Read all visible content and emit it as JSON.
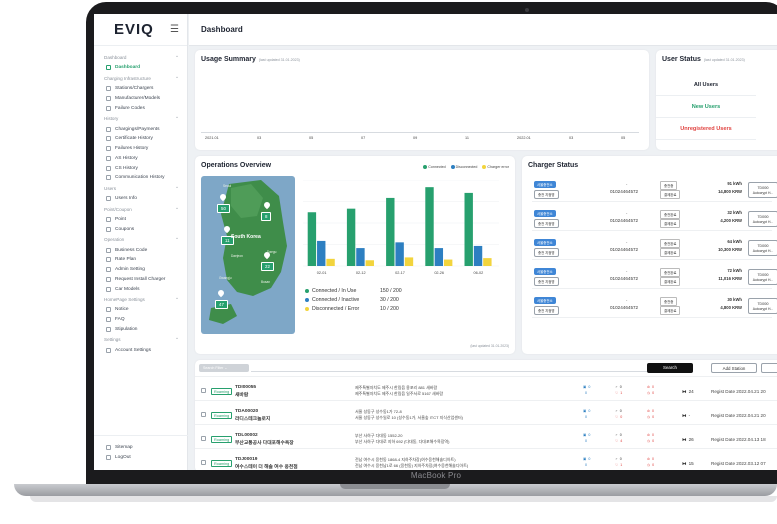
{
  "device": {
    "label": "MacBook Pro"
  },
  "sidebar": {
    "logo": "EVIQ",
    "sections": [
      {
        "title": "Dashboard",
        "items": [
          {
            "label": "Dashboard",
            "active": true
          }
        ]
      },
      {
        "title": "Charging Infrastructure",
        "items": [
          {
            "label": "Stations/Chargers"
          },
          {
            "label": "Manufacturer/Models"
          },
          {
            "label": "Failure Codes"
          }
        ]
      },
      {
        "title": "History",
        "items": [
          {
            "label": "Chargings/Payments"
          },
          {
            "label": "Certificate History"
          },
          {
            "label": "Failures History"
          },
          {
            "label": "AS History"
          },
          {
            "label": "CS History"
          },
          {
            "label": "Communication History"
          }
        ]
      },
      {
        "title": "Users",
        "items": [
          {
            "label": "Users Info"
          }
        ]
      },
      {
        "title": "Point/Coupon",
        "items": [
          {
            "label": "Point"
          },
          {
            "label": "Coupons"
          }
        ]
      },
      {
        "title": "Operation",
        "items": [
          {
            "label": "Business Code"
          },
          {
            "label": "Rate Plan"
          },
          {
            "label": "Admin Setting"
          },
          {
            "label": "Request Install Charger"
          },
          {
            "label": "Car Models"
          }
        ]
      },
      {
        "title": "HomePage Settings",
        "items": [
          {
            "label": "Notice"
          },
          {
            "label": "FAQ"
          },
          {
            "label": "Stipulation"
          }
        ]
      },
      {
        "title": "Settings",
        "items": [
          {
            "label": "Account Settings"
          }
        ]
      }
    ],
    "bottom": [
      {
        "label": "Sitemap"
      },
      {
        "label": "LogOut"
      }
    ]
  },
  "header": {
    "title": "Dashboard"
  },
  "usage": {
    "title": "Usage Summary",
    "subtitle": "(last updated 31.01.2023)",
    "xticks": [
      "2021.01",
      "03",
      "05",
      "07",
      "09",
      "11",
      "2022.01",
      "03",
      "05"
    ]
  },
  "user_status": {
    "title": "User Status",
    "subtitle": "(last updated 31.01.2023)",
    "rows": [
      {
        "label": "All Users",
        "color": "#1d2330"
      },
      {
        "label": "New Users",
        "color": "#27a06e"
      },
      {
        "label": "Unregistered Users",
        "color": "#e0423f"
      }
    ]
  },
  "operations": {
    "title": "Operations Overview",
    "legend": [
      {
        "label": "Connected",
        "color": "#27a06e"
      },
      {
        "label": "Disconnected",
        "color": "#2d7fc1"
      },
      {
        "label": "Charger error",
        "color": "#f2d43d"
      }
    ],
    "map": {
      "region_label": "South Korea",
      "city_labels": [
        "Seoul",
        "Daejeon",
        "Daegu",
        "Gwangju",
        "Busan"
      ],
      "pins": [
        "50",
        "8",
        "11",
        "22",
        "47"
      ]
    },
    "stats": [
      {
        "label": "Connected / In Use",
        "value": "150 / 200",
        "color": "#27a06e"
      },
      {
        "label": "Connected / Inactive",
        "value": "30 / 200",
        "color": "#2d7fc1"
      },
      {
        "label": "Disconnected / Error",
        "value": "10 / 200",
        "color": "#f2d43d"
      }
    ],
    "updated": "(last updated 31.01.2023)"
  },
  "chart_data": {
    "type": "bar",
    "categories": [
      "02-01",
      "02-12",
      "02-17",
      "02-26",
      "06-02"
    ],
    "series": [
      {
        "name": "Connected",
        "values": [
          75,
          80,
          95,
          110,
          102
        ]
      },
      {
        "name": "Disconnected",
        "values": [
          35,
          25,
          33,
          25,
          28
        ]
      },
      {
        "name": "Charger error",
        "values": [
          10,
          8,
          12,
          9,
          11
        ]
      }
    ],
    "ylim": [
      0,
      120
    ],
    "grid": true
  },
  "charger_status": {
    "title": "Charger Status",
    "rows": [
      {
        "badge": "서울충전소",
        "station": "충전 지점명",
        "phone": "01024464572",
        "type": "충전중",
        "mode": "결제완료",
        "kwh": "91 kWh",
        "krw": "14,800 KRW",
        "id_top": "TDI000",
        "id_bottom": "Autocrypt H..."
      },
      {
        "badge": "서울충전소",
        "station": "충전 지점명",
        "phone": "01024464572",
        "type": "충전완료",
        "mode": "결제완료",
        "kwh": "32 kWh",
        "krw": "4,200 KRW",
        "id_top": "TDI000",
        "id_bottom": "Autocrypt H..."
      },
      {
        "badge": "서울충전소",
        "station": "충전 지점명",
        "phone": "01024464572",
        "type": "충전완료",
        "mode": "결제완료",
        "kwh": "64 kWh",
        "krw": "10,300 KRW",
        "id_top": "TDI000",
        "id_bottom": "Autocrypt H..."
      },
      {
        "badge": "서울충전소",
        "station": "충전 지점명",
        "phone": "01024464572",
        "type": "충전완료",
        "mode": "결제완료",
        "kwh": "72 kWh",
        "krw": "11,016 KRW",
        "id_top": "TDI000",
        "id_bottom": "Autocrypt H..."
      },
      {
        "badge": "서울충전소",
        "station": "충전 지점명",
        "phone": "01024464572",
        "type": "충전중",
        "mode": "결제완료",
        "kwh": "30 kWh",
        "krw": "4,800 KRW",
        "id_top": "TDI000",
        "id_bottom": "Autocrypt H..."
      }
    ]
  },
  "stations": {
    "filter_label": "Search Filter",
    "search_label": "Search",
    "add_label": "Add Station",
    "rows": [
      {
        "roaming": "Roaming",
        "code": "TDI00055",
        "name": "새바람",
        "addr1": "제주특별자치도 제주시 한림읍 용포리 881 새바람",
        "addr2": "제주특별자치도 제주시 한림읍 일주서로 5167 새바람",
        "c1": "0",
        "c2": "0",
        "c3": "0",
        "c4": "0",
        "c5": "0",
        "c6": "1",
        "c7": "0",
        "count": "24",
        "regist": "Regist Date 2022.04.21 20"
      },
      {
        "roaming": "Roaming",
        "code": "TDA00020",
        "name": "라디스테크놀로지",
        "addr1": "서울 성동구 성수동1가 72-8",
        "addr2": "서울 성동구 성수일로 10 (성수동1가, 서울숲 ITCT 지식산업센터)",
        "c1": "0",
        "c2": "0",
        "c3": "0",
        "c4": "0",
        "c5": "0",
        "c6": "0",
        "c7": "0",
        "count": "-",
        "regist": "Regist Date 2022.04.21 20"
      },
      {
        "roaming": "Roaming",
        "code": "TDL00002",
        "name": "부산교통공사 다대포해수욕장",
        "addr1": "부산 사하구 다대동 1552-20",
        "addr2": "부산 사하구 다대로 지하 692 (다대동, 다대포해수욕장역)",
        "c1": "0",
        "c2": "0",
        "c3": "0",
        "c4": "0",
        "c5": "0",
        "c6": "4",
        "c7": "0",
        "count": "26",
        "regist": "Regist Date 2022.04.13 18"
      },
      {
        "roaming": "Roaming",
        "code": "TDJ00019",
        "name": "여수스테이 더 해솔 여수 웅천점",
        "addr1": "전남 여수시 웅천동 1868-4 지하주차장(여수웅천해솔디아트)",
        "addr2": "전남 여수시 웅천남1로 66 (웅천동) 지하주차장(여수웅천해솔디아트)",
        "c1": "0",
        "c2": "0",
        "c3": "0",
        "c4": "0",
        "c5": "0",
        "c6": "1",
        "c7": "0",
        "count": "15",
        "regist": "Regist Date 2022.03.12 07"
      }
    ]
  }
}
